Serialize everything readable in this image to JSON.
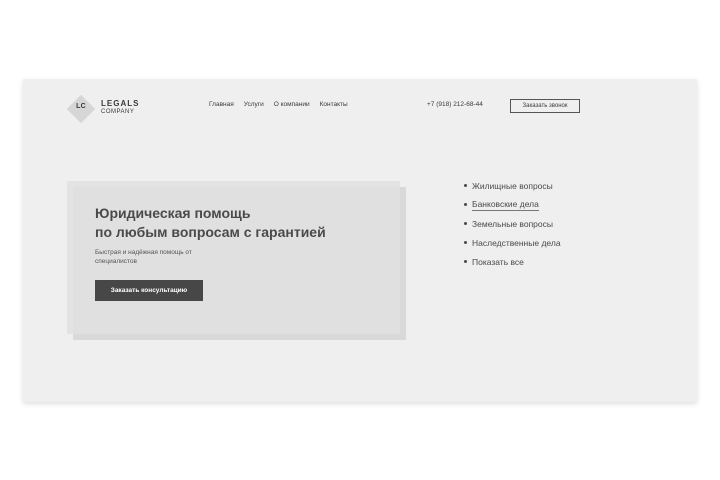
{
  "logo": {
    "mark": "LC",
    "name": "LEGALS",
    "sub": "COMPANY"
  },
  "nav": [
    {
      "label": "Главная"
    },
    {
      "label": "Услуги"
    },
    {
      "label": "О компании"
    },
    {
      "label": "Контакты"
    }
  ],
  "header": {
    "phone": "+7 (918) 212-68-44",
    "callback_label": "Заказать звонок"
  },
  "hero": {
    "title_line1": "Юридическая помощь",
    "title_line2": "по любым вопросам с гарантией",
    "subtitle": "Быстрая и надёжная помощь от специалистов",
    "cta_label": "Заказать консультацию"
  },
  "categories": [
    {
      "label": "Жилищные вопросы"
    },
    {
      "label": "Банковские дела"
    },
    {
      "label": "Земельные вопросы"
    },
    {
      "label": "Наследственные дела"
    },
    {
      "label": "Показать все"
    }
  ],
  "colors": {
    "frame_bg": "#efefef",
    "hero_bg": "#d9d9d9",
    "button_dark": "#474747",
    "text": "#3a3a3a"
  }
}
